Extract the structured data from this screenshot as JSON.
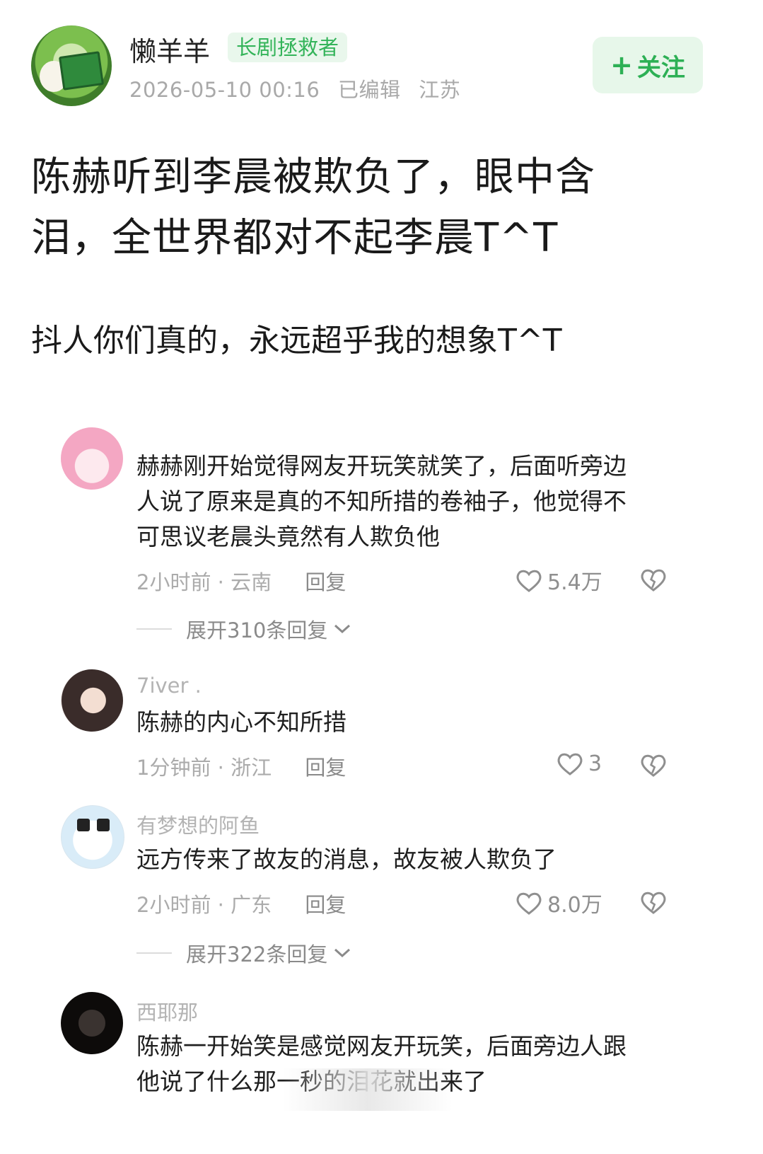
{
  "post": {
    "username": "懒羊羊",
    "badge": "长剧拯救者",
    "datetime": "2026-05-10 00:16",
    "edited": "已编辑",
    "location": "江苏",
    "follow_label": "关注",
    "follow_icon": "plus-icon",
    "title_line1": "陈赫听到李晨被欺负了，眼中含",
    "title_line2": "泪，全世界都对不起李晨T^T",
    "subtitle": "抖人你们真的，永远超乎我的想象T^T"
  },
  "comments": [
    {
      "name": "",
      "text_lines": [
        "赫赫刚开始觉得网友开玩笑就笑了，后面听旁边",
        "人说了原来是真的不知所措的卷袖子，他觉得不",
        "可思议老晨头竟然有人欺负他"
      ],
      "time": "2小时前",
      "region": "云南",
      "reply_label": "回复",
      "likes": "5.4万",
      "expand": "展开310条回复"
    },
    {
      "name": "7iver .",
      "text_lines": [
        "陈赫的内心不知所措"
      ],
      "time": "1分钟前",
      "region": "浙江",
      "reply_label": "回复",
      "likes": "3"
    },
    {
      "name": "有梦想的阿鱼",
      "text_lines": [
        "远方传来了故友的消息，故友被人欺负了"
      ],
      "time": "2小时前",
      "region": "广东",
      "reply_label": "回复",
      "likes": "8.0万",
      "expand": "展开322条回复"
    },
    {
      "name": "西耶那",
      "text_lines": [
        "陈赫一开始笑是感觉网友开玩笑，后面旁边人跟",
        "他说了什么那一秒的泪花就出来了"
      ]
    }
  ],
  "colors": {
    "accent_green": "#2db055",
    "badge_bg": "#e9f7ec",
    "muted_text": "#a9a9a9"
  }
}
